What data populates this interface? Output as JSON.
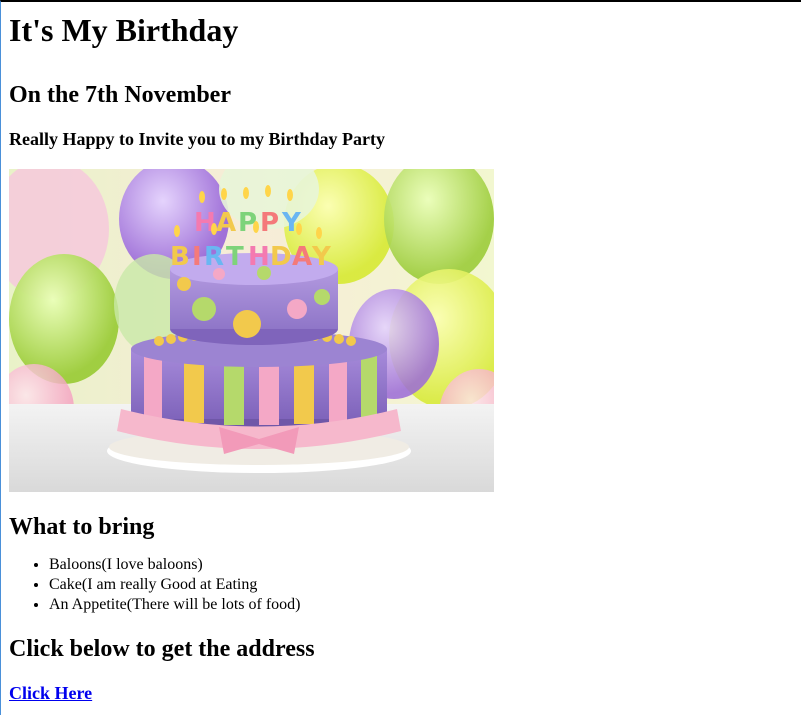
{
  "page": {
    "title": "It's My Birthday",
    "date_heading": "On the 7th November",
    "invite_text": "Really Happy to Invite you to my Birthday Party"
  },
  "image": {
    "description_icon": "birthday-cake-image",
    "topper_text": [
      "HAPPY",
      "BIRTHDAY"
    ],
    "colors": {
      "cake_purple": "#a98fd6",
      "stripe_yellow": "#f2c94c",
      "stripe_pink": "#f4a8c6",
      "stripe_green": "#b5d96b",
      "ribbon_pink": "#f6b8cc"
    }
  },
  "bring": {
    "heading": "What to bring",
    "items": [
      "Baloons(I love baloons)",
      "Cake(I am really Good at Eating",
      "An Appetite(There will be lots of food)"
    ]
  },
  "address": {
    "heading": "Click below to get the address",
    "link_label": "Click Here"
  }
}
